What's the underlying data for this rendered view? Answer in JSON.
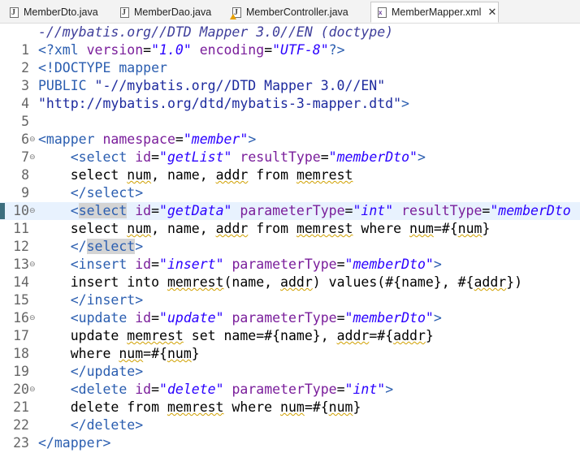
{
  "tabs": [
    {
      "label": "MemberDto.java",
      "icon": "java-file-icon"
    },
    {
      "label": "MemberDao.java",
      "icon": "java-file-icon"
    },
    {
      "label": "MemberController.java",
      "icon": "java-file-warning-icon"
    },
    {
      "label": "MemberMapper.xml",
      "icon": "xml-file-icon",
      "active": true,
      "close": "✕"
    }
  ],
  "editor": {
    "hint": "-//mybatis.org//DTD Mapper 3.0//EN (doctype)",
    "current_line": 10,
    "lines": [
      {
        "num": "1",
        "tokens": [
          {
            "c": "tag",
            "t": "<?xml "
          },
          {
            "c": "attr",
            "t": "version"
          },
          {
            "c": "text",
            "t": "="
          },
          {
            "c": "val",
            "t": "\"1.0\""
          },
          {
            "c": "text",
            "t": " "
          },
          {
            "c": "attr",
            "t": "encoding"
          },
          {
            "c": "text",
            "t": "="
          },
          {
            "c": "val",
            "t": "\"UTF-8\""
          },
          {
            "c": "tag",
            "t": "?>"
          }
        ]
      },
      {
        "num": "2",
        "tokens": [
          {
            "c": "tag",
            "t": "<!DOCTYPE mapper"
          }
        ]
      },
      {
        "num": "3",
        "tokens": [
          {
            "c": "tag",
            "t": "PUBLIC "
          },
          {
            "c": "dstr",
            "t": "\"-//mybatis.org//DTD Mapper 3.0//EN\""
          }
        ]
      },
      {
        "num": "4",
        "tokens": [
          {
            "c": "dstr",
            "t": "\"http://mybatis.org/dtd/mybatis-3-mapper.dtd\""
          },
          {
            "c": "tag",
            "t": ">"
          }
        ]
      },
      {
        "num": "5",
        "tokens": []
      },
      {
        "num": "6",
        "fold": "⊖",
        "tokens": [
          {
            "c": "tag",
            "t": "<mapper "
          },
          {
            "c": "attr",
            "t": "namespace"
          },
          {
            "c": "text",
            "t": "="
          },
          {
            "c": "val",
            "t": "\"member\""
          },
          {
            "c": "tag",
            "t": ">"
          }
        ]
      },
      {
        "num": "7",
        "fold": "⊖",
        "tokens": [
          {
            "c": "text",
            "t": "    "
          },
          {
            "c": "tag",
            "t": "<select "
          },
          {
            "c": "attr",
            "t": "id"
          },
          {
            "c": "text",
            "t": "="
          },
          {
            "c": "val",
            "t": "\"getList\""
          },
          {
            "c": "text",
            "t": " "
          },
          {
            "c": "attr",
            "t": "resultType"
          },
          {
            "c": "text",
            "t": "="
          },
          {
            "c": "val",
            "t": "\"memberDto\""
          },
          {
            "c": "tag",
            "t": ">"
          }
        ]
      },
      {
        "num": "8",
        "tokens": [
          {
            "c": "text",
            "t": "    select "
          },
          {
            "c": "sq",
            "t": "num"
          },
          {
            "c": "text",
            "t": ", name, "
          },
          {
            "c": "sq",
            "t": "addr"
          },
          {
            "c": "text",
            "t": " from "
          },
          {
            "c": "sq",
            "t": "memrest"
          }
        ]
      },
      {
        "num": "9",
        "tokens": [
          {
            "c": "text",
            "t": "    "
          },
          {
            "c": "tag",
            "t": "</select>"
          }
        ]
      },
      {
        "num": "10",
        "fold": "⊖",
        "bookmark": true,
        "tokens": [
          {
            "c": "text",
            "t": "    "
          },
          {
            "c": "tag",
            "t": "<"
          },
          {
            "c": "taghl",
            "t": "select"
          },
          {
            "c": "tag",
            "t": " "
          },
          {
            "c": "attr",
            "t": "id"
          },
          {
            "c": "text",
            "t": "="
          },
          {
            "c": "val",
            "t": "\"getData\""
          },
          {
            "c": "text",
            "t": " "
          },
          {
            "c": "attr",
            "t": "parameterType"
          },
          {
            "c": "text",
            "t": "="
          },
          {
            "c": "val",
            "t": "\"int\""
          },
          {
            "c": "text",
            "t": " "
          },
          {
            "c": "attr",
            "t": "resultType"
          },
          {
            "c": "text",
            "t": "="
          },
          {
            "c": "val",
            "t": "\"memberDto"
          }
        ]
      },
      {
        "num": "11",
        "tokens": [
          {
            "c": "text",
            "t": "    select "
          },
          {
            "c": "sq",
            "t": "num"
          },
          {
            "c": "text",
            "t": ", name, "
          },
          {
            "c": "sq",
            "t": "addr"
          },
          {
            "c": "text",
            "t": " from "
          },
          {
            "c": "sq",
            "t": "memrest"
          },
          {
            "c": "text",
            "t": " where "
          },
          {
            "c": "sq",
            "t": "num"
          },
          {
            "c": "text",
            "t": "=#{"
          },
          {
            "c": "sq",
            "t": "num"
          },
          {
            "c": "text",
            "t": "}"
          }
        ]
      },
      {
        "num": "12",
        "tokens": [
          {
            "c": "text",
            "t": "    "
          },
          {
            "c": "tag",
            "t": "</"
          },
          {
            "c": "taghl",
            "t": "select"
          },
          {
            "c": "tag",
            "t": ">"
          }
        ]
      },
      {
        "num": "13",
        "fold": "⊖",
        "tokens": [
          {
            "c": "text",
            "t": "    "
          },
          {
            "c": "tag",
            "t": "<insert "
          },
          {
            "c": "attr",
            "t": "id"
          },
          {
            "c": "text",
            "t": "="
          },
          {
            "c": "val",
            "t": "\"insert\""
          },
          {
            "c": "text",
            "t": " "
          },
          {
            "c": "attr",
            "t": "parameterType"
          },
          {
            "c": "text",
            "t": "="
          },
          {
            "c": "val",
            "t": "\"memberDto\""
          },
          {
            "c": "tag",
            "t": ">"
          }
        ]
      },
      {
        "num": "14",
        "tokens": [
          {
            "c": "text",
            "t": "    insert into "
          },
          {
            "c": "sq",
            "t": "memrest"
          },
          {
            "c": "text",
            "t": "(name, "
          },
          {
            "c": "sq",
            "t": "addr"
          },
          {
            "c": "text",
            "t": ") values(#{name}, #{"
          },
          {
            "c": "sq",
            "t": "addr"
          },
          {
            "c": "text",
            "t": "})"
          }
        ]
      },
      {
        "num": "15",
        "tokens": [
          {
            "c": "text",
            "t": "    "
          },
          {
            "c": "tag",
            "t": "</insert>"
          }
        ]
      },
      {
        "num": "16",
        "fold": "⊖",
        "tokens": [
          {
            "c": "text",
            "t": "    "
          },
          {
            "c": "tag",
            "t": "<update "
          },
          {
            "c": "attr",
            "t": "id"
          },
          {
            "c": "text",
            "t": "="
          },
          {
            "c": "val",
            "t": "\"update\""
          },
          {
            "c": "text",
            "t": " "
          },
          {
            "c": "attr",
            "t": "parameterType"
          },
          {
            "c": "text",
            "t": "="
          },
          {
            "c": "val",
            "t": "\"memberDto\""
          },
          {
            "c": "tag",
            "t": ">"
          }
        ]
      },
      {
        "num": "17",
        "tokens": [
          {
            "c": "text",
            "t": "    update "
          },
          {
            "c": "sq",
            "t": "memrest"
          },
          {
            "c": "text",
            "t": " set name=#{name}, "
          },
          {
            "c": "sq",
            "t": "addr"
          },
          {
            "c": "text",
            "t": "=#{"
          },
          {
            "c": "sq",
            "t": "addr"
          },
          {
            "c": "text",
            "t": "}"
          }
        ]
      },
      {
        "num": "18",
        "tokens": [
          {
            "c": "text",
            "t": "    where "
          },
          {
            "c": "sq",
            "t": "num"
          },
          {
            "c": "text",
            "t": "=#{"
          },
          {
            "c": "sq",
            "t": "num"
          },
          {
            "c": "text",
            "t": "}"
          }
        ]
      },
      {
        "num": "19",
        "tokens": [
          {
            "c": "text",
            "t": "    "
          },
          {
            "c": "tag",
            "t": "</update>"
          }
        ]
      },
      {
        "num": "20",
        "fold": "⊖",
        "tokens": [
          {
            "c": "text",
            "t": "    "
          },
          {
            "c": "tag",
            "t": "<delete "
          },
          {
            "c": "attr",
            "t": "id"
          },
          {
            "c": "text",
            "t": "="
          },
          {
            "c": "val",
            "t": "\"delete\""
          },
          {
            "c": "text",
            "t": " "
          },
          {
            "c": "attr",
            "t": "parameterType"
          },
          {
            "c": "text",
            "t": "="
          },
          {
            "c": "val",
            "t": "\"int\""
          },
          {
            "c": "tag",
            "t": ">"
          }
        ]
      },
      {
        "num": "21",
        "tokens": [
          {
            "c": "text",
            "t": "    delete from "
          },
          {
            "c": "sq",
            "t": "memrest"
          },
          {
            "c": "text",
            "t": " where "
          },
          {
            "c": "sq",
            "t": "num"
          },
          {
            "c": "text",
            "t": "=#{"
          },
          {
            "c": "sq",
            "t": "num"
          },
          {
            "c": "text",
            "t": "}"
          }
        ]
      },
      {
        "num": "22",
        "tokens": [
          {
            "c": "text",
            "t": "    "
          },
          {
            "c": "tag",
            "t": "</delete>"
          }
        ]
      },
      {
        "num": "23",
        "tokens": [
          {
            "c": "tag",
            "t": "</mapper>"
          }
        ]
      }
    ]
  },
  "colors": {
    "tag": "#2b5eb0",
    "attr": "#7a1e9b",
    "value": "#2a00ff",
    "current_line": "#e8f2fe"
  }
}
